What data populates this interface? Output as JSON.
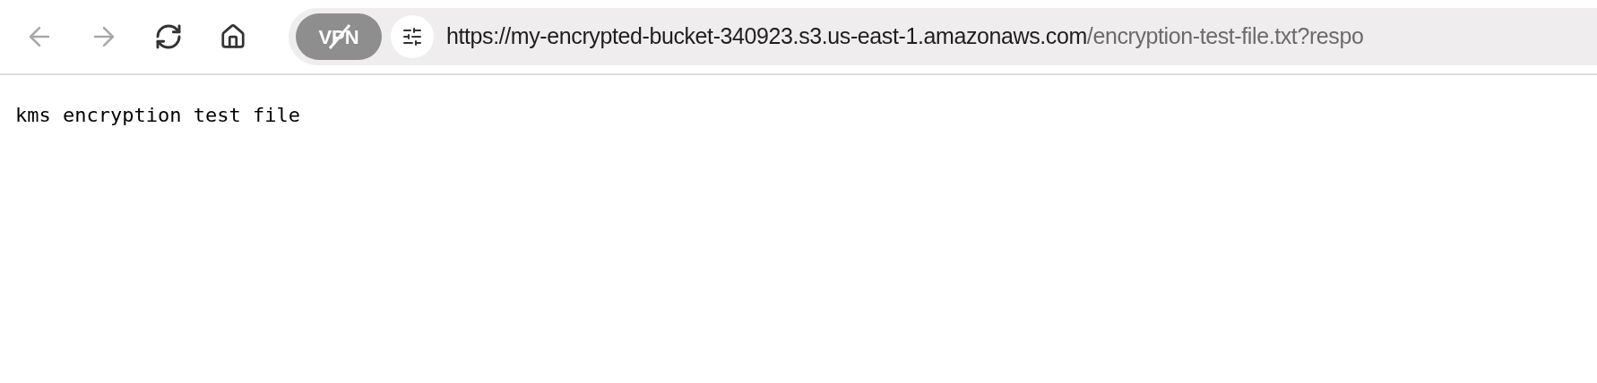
{
  "toolbar": {
    "back": {
      "disabled": true
    },
    "forward": {
      "disabled": true
    },
    "vpn": {
      "label": "VPN",
      "on": false
    },
    "address": {
      "host": "https://my-encrypted-bucket-340923.s3.us-east-1.amazonaws.com",
      "path": "/encryption-test-file.txt?respo"
    }
  },
  "page": {
    "text": "kms encryption test file"
  }
}
